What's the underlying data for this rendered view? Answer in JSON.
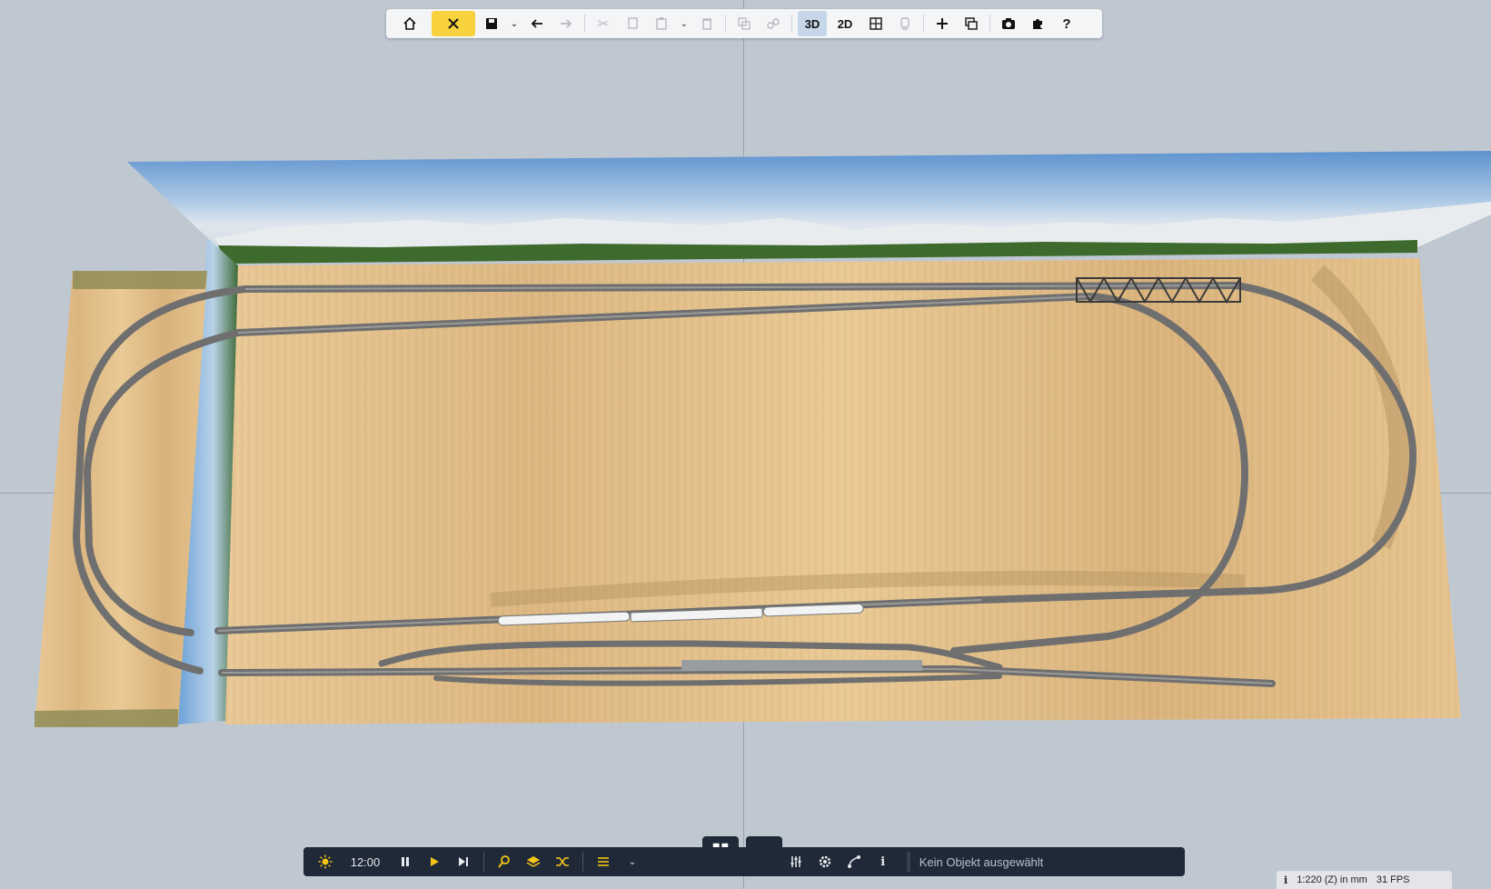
{
  "toolbar_top": {
    "items": [
      {
        "name": "home-icon",
        "glyph": "home"
      },
      {
        "name": "edit-tools-icon",
        "glyph": "tools"
      },
      {
        "name": "save-icon",
        "glyph": "save"
      },
      {
        "name": "undo-icon",
        "glyph": "undo"
      },
      {
        "name": "redo-icon",
        "glyph": "redo"
      },
      {
        "name": "cut-icon",
        "glyph": "cut"
      },
      {
        "name": "copy-icon",
        "glyph": "copy"
      },
      {
        "name": "paste-icon",
        "glyph": "paste"
      },
      {
        "name": "delete-icon",
        "glyph": "trash"
      },
      {
        "name": "group-icon",
        "glyph": "group"
      },
      {
        "name": "link-icon",
        "glyph": "link"
      }
    ],
    "view_3d_label": "3D",
    "view_2d_label": "2D",
    "active_colors": {
      "tools": "#f7d23e",
      "view3d": "#c6d7ea"
    }
  },
  "bottom_toolbar": {
    "time": "12:00",
    "status_text": "Kein Objekt ausgewählt",
    "icons": [
      "sun-icon",
      "pause-icon",
      "play-icon",
      "step-icon",
      "search-icon",
      "layers-icon",
      "shuffle-icon",
      "list-icon",
      "mixer-icon",
      "settings-icon",
      "route-icon",
      "info-icon"
    ]
  },
  "view_switch": {
    "icons": [
      "grid-view-icon",
      "terrain-view-icon"
    ]
  },
  "status_bar": {
    "info": "i",
    "scale": "1:220 (Z) in mm",
    "fps": "31 FPS"
  },
  "scene": {
    "board_color": "#e4c08c",
    "track_color": "#7b7b7b",
    "sky_color": "#8fb6dc"
  }
}
